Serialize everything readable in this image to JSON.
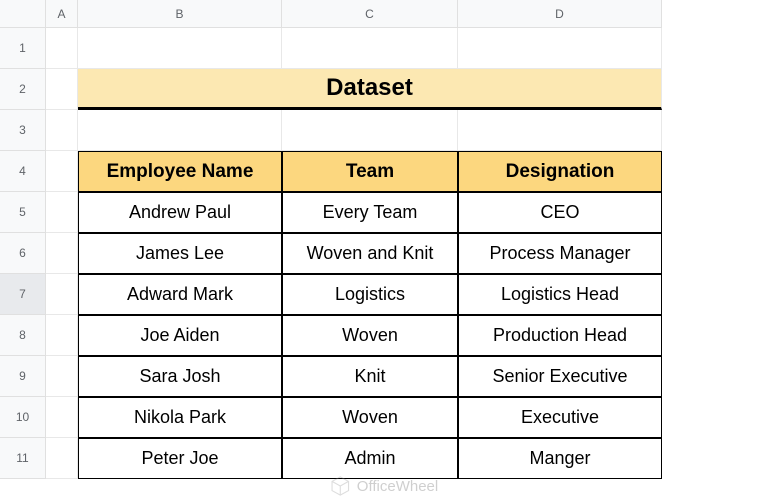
{
  "columns": [
    "A",
    "B",
    "C",
    "D"
  ],
  "rows": [
    "1",
    "2",
    "3",
    "4",
    "5",
    "6",
    "7",
    "8",
    "9",
    "10",
    "11"
  ],
  "selectedRow": "7",
  "title": "Dataset",
  "headers": [
    "Employee Name",
    "Team",
    "Designation"
  ],
  "data": [
    [
      "Andrew Paul",
      "Every Team",
      "CEO"
    ],
    [
      "James Lee",
      "Woven and Knit",
      "Process Manager"
    ],
    [
      "Adward Mark",
      "Logistics",
      "Logistics Head"
    ],
    [
      "Joe Aiden",
      "Woven",
      "Production Head"
    ],
    [
      "Sara Josh",
      "Knit",
      "Senior Executive"
    ],
    [
      "Nikola Park",
      "Woven",
      "Executive"
    ],
    [
      "Peter Joe",
      "Admin",
      "Manger"
    ]
  ],
  "watermark": "OfficeWheel",
  "chart_data": {
    "type": "table",
    "title": "Dataset",
    "columns": [
      "Employee Name",
      "Team",
      "Designation"
    ],
    "rows": [
      {
        "Employee Name": "Andrew Paul",
        "Team": "Every Team",
        "Designation": "CEO"
      },
      {
        "Employee Name": "James Lee",
        "Team": "Woven and Knit",
        "Designation": "Process Manager"
      },
      {
        "Employee Name": "Adward Mark",
        "Team": "Logistics",
        "Designation": "Logistics Head"
      },
      {
        "Employee Name": "Joe Aiden",
        "Team": "Woven",
        "Designation": "Production Head"
      },
      {
        "Employee Name": "Sara Josh",
        "Team": "Knit",
        "Designation": "Senior Executive"
      },
      {
        "Employee Name": "Nikola Park",
        "Team": "Woven",
        "Designation": "Executive"
      },
      {
        "Employee Name": "Peter Joe",
        "Team": "Admin",
        "Designation": "Manger"
      }
    ]
  }
}
